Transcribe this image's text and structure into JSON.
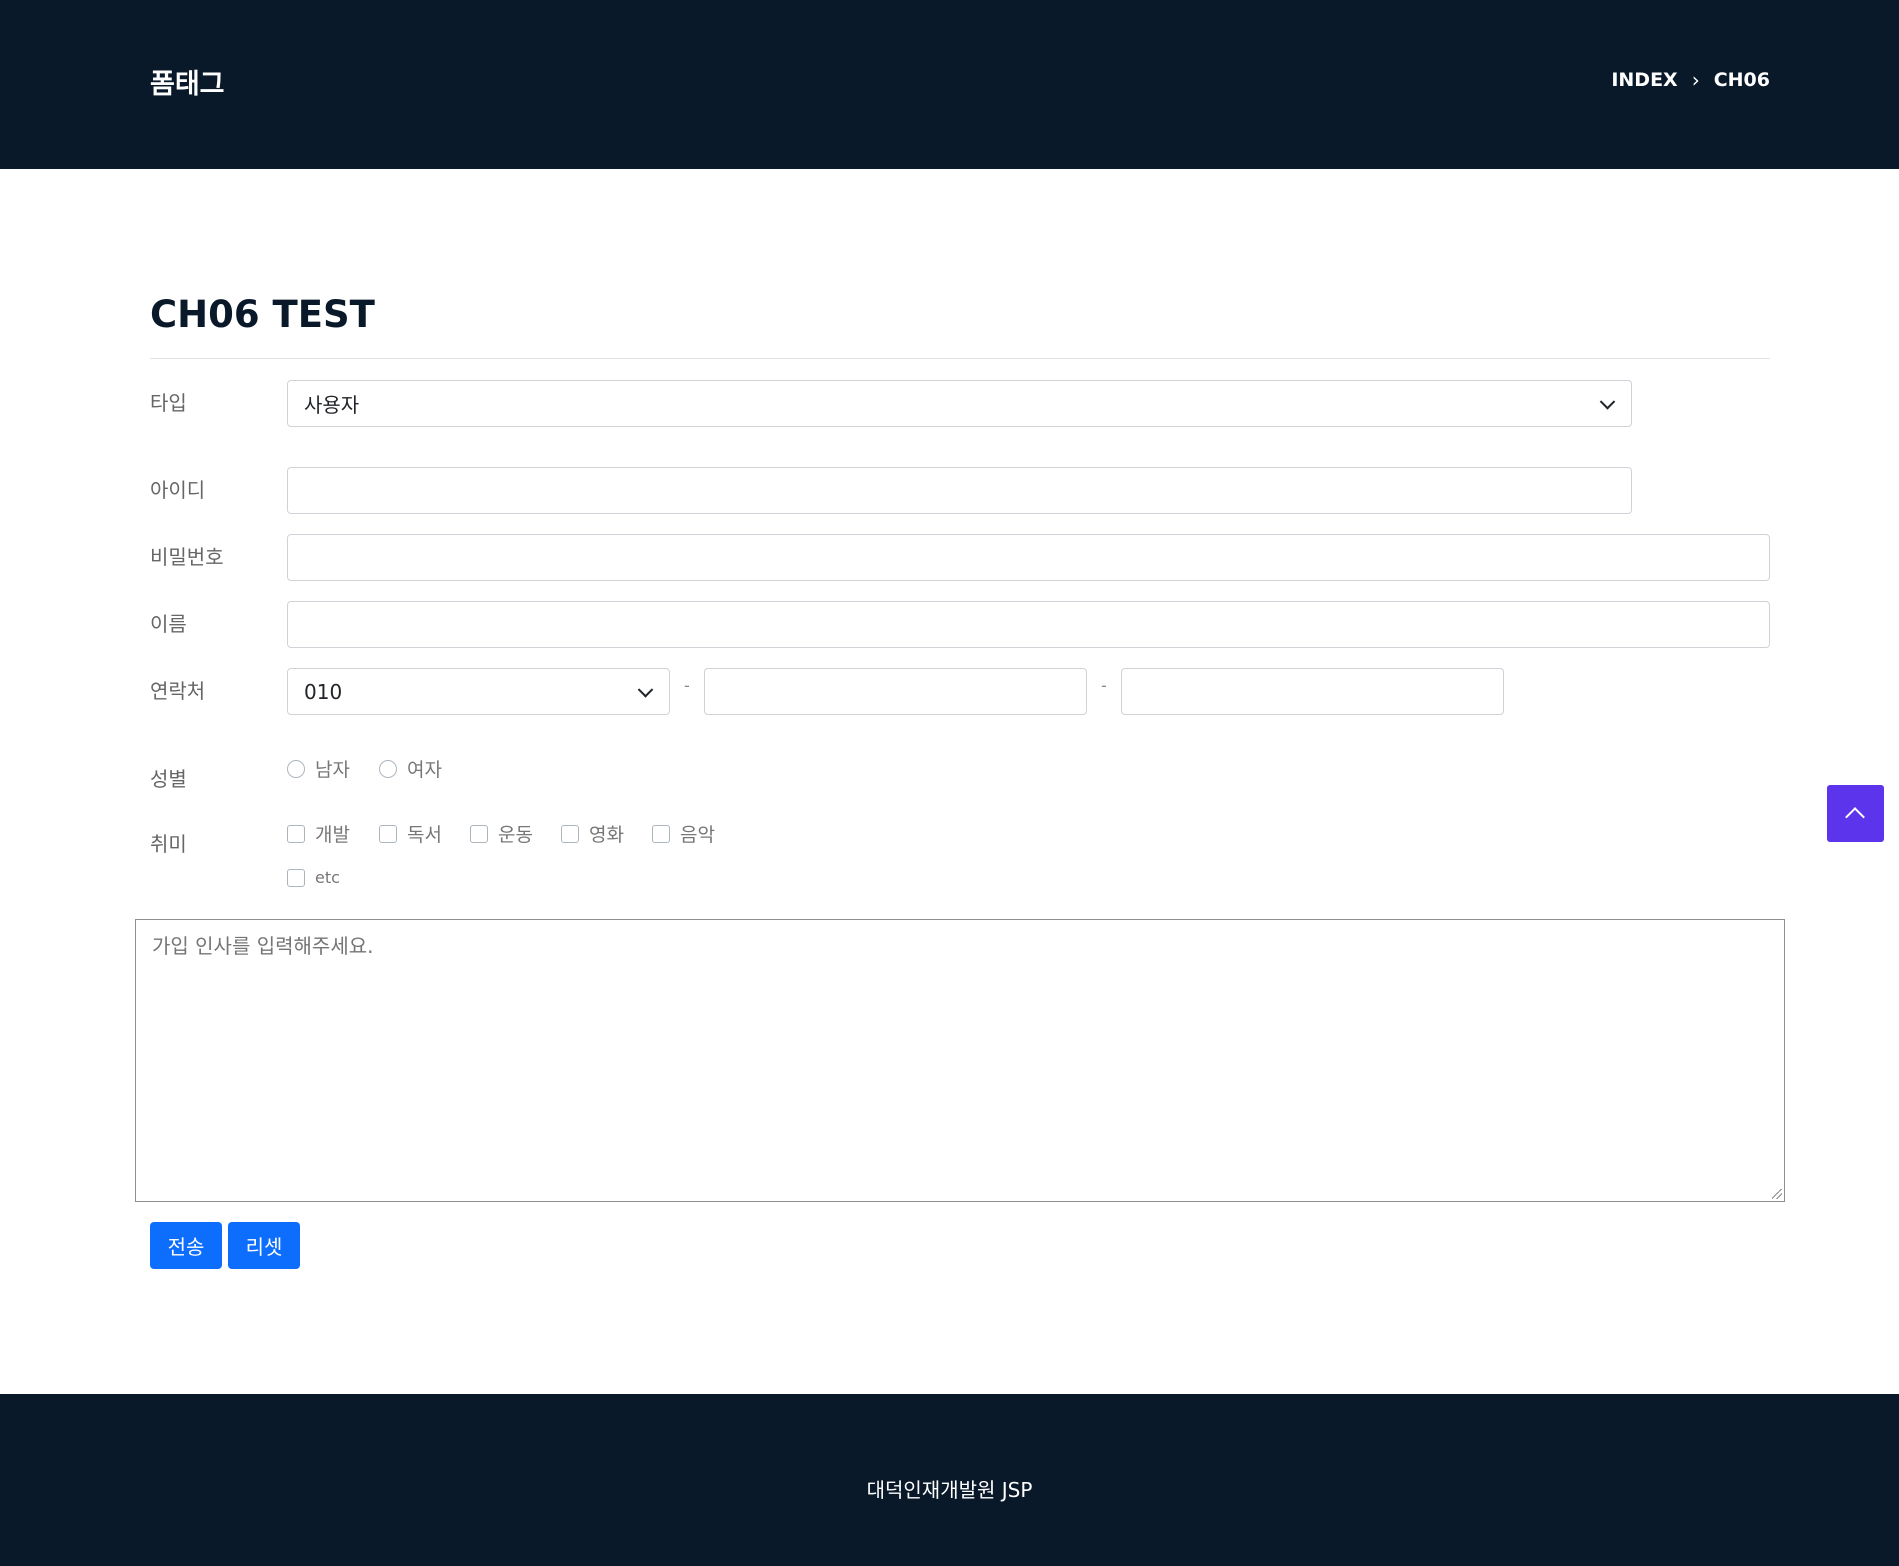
{
  "header": {
    "brand": "폼태그",
    "breadcrumb": [
      "INDEX",
      "CH06"
    ]
  },
  "page": {
    "title": "CH06 TEST"
  },
  "form": {
    "type": {
      "label": "타입",
      "selected": "사용자"
    },
    "id": {
      "label": "아이디",
      "value": ""
    },
    "password": {
      "label": "비밀번호",
      "value": ""
    },
    "name": {
      "label": "이름",
      "value": ""
    },
    "phone": {
      "label": "연락처",
      "prefix": "010",
      "dash": "-",
      "middle": "",
      "last": ""
    },
    "gender": {
      "label": "성별",
      "options": [
        "남자",
        "여자"
      ]
    },
    "hobby": {
      "label": "취미",
      "options": [
        "개발",
        "독서",
        "운동",
        "영화",
        "음악",
        "etc"
      ]
    },
    "greeting": {
      "placeholder": "가입 인사를 입력해주세요."
    },
    "submit_label": "전송",
    "reset_label": "리셋"
  },
  "footer": {
    "text": "대덕인재개발원 JSP"
  },
  "colors": {
    "header_bg": "#0a192a",
    "primary_button": "#0d6efd",
    "scroll_top_button": "#5b34eb"
  },
  "icons": {
    "select_arrow": "chevron-down-icon",
    "breadcrumb_separator": "chevron-right-icon",
    "scroll_top": "chevron-up-icon"
  }
}
